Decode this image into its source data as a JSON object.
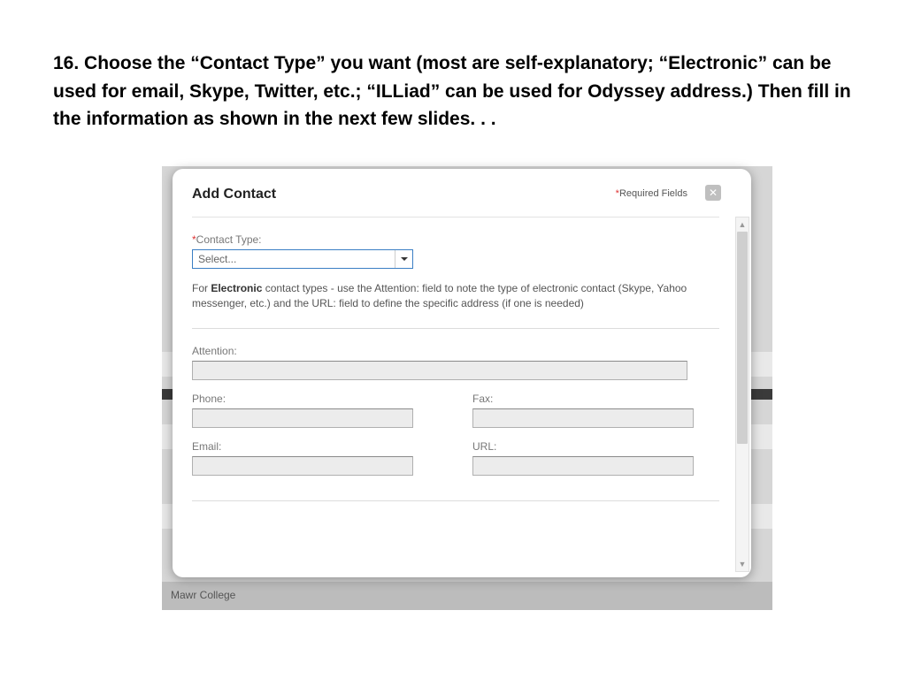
{
  "slide": {
    "title": "16. Choose the “Contact Type” you want (most are self-explanatory; “Electronic” can be used for email, Skype, Twitter, etc.; “ILLiad” can be used for Odyssey address.) Then fill in the information as shown in the next few slides. . ."
  },
  "background": {
    "college_text": "Mawr College"
  },
  "modal": {
    "title": "Add Contact",
    "required_label": "Required Fields",
    "close_glyph": "✕",
    "contact_type_label": "Contact Type:",
    "contact_type_selected": "Select...",
    "help_prefix": "For ",
    "help_bold": "Electronic",
    "help_suffix": " contact types -  use the Attention: field to note the type of electronic contact (Skype, Yahoo messenger, etc.) and the URL: field to define the specific address (if one is needed)",
    "attention_label": "Attention:",
    "phone_label": "Phone:",
    "fax_label": "Fax:",
    "email_label": "Email:",
    "url_label": "URL:",
    "values": {
      "attention": "",
      "phone": "",
      "fax": "",
      "email": "",
      "url": ""
    }
  }
}
